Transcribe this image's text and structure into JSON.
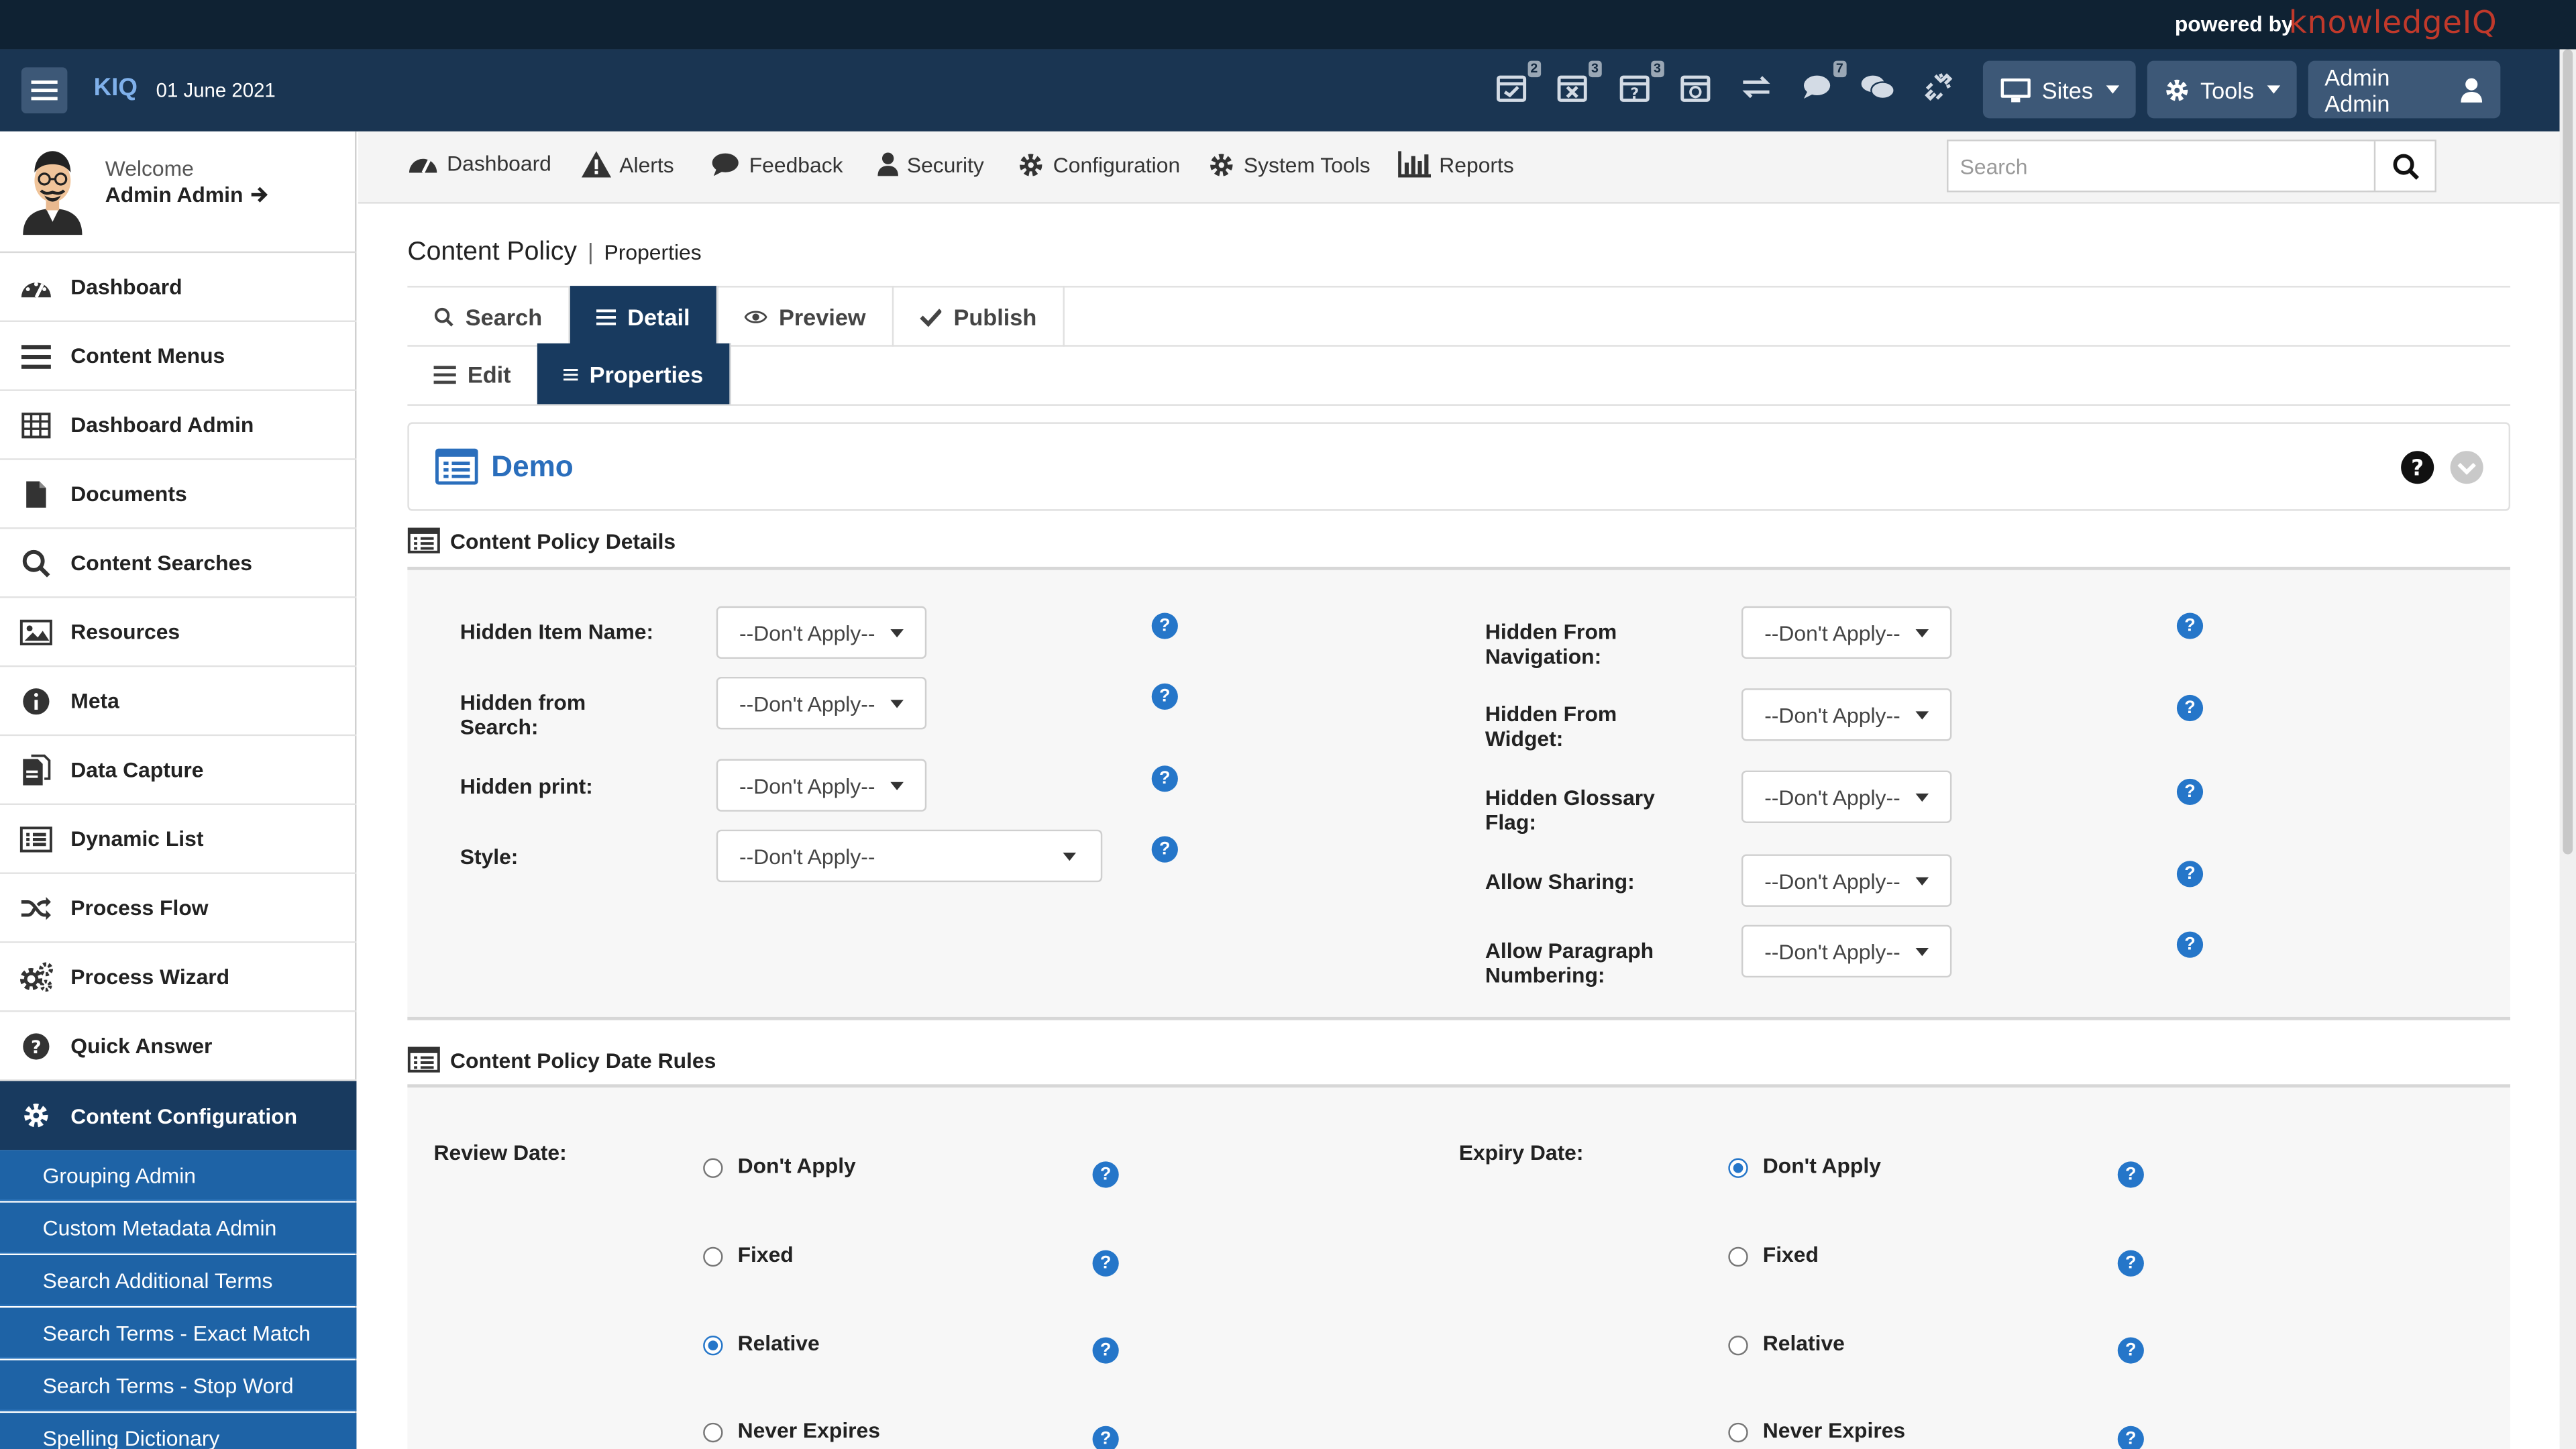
{
  "powered": {
    "text": "powered by",
    "logo": "knowledgeIQ"
  },
  "header": {
    "app_name": "KIQ",
    "date": "01 June 2021",
    "icons": [
      {
        "name": "calendar-check-icon",
        "badge": "2"
      },
      {
        "name": "calendar-times-icon",
        "badge": "3"
      },
      {
        "name": "calendar-question-icon",
        "badge": "3"
      },
      {
        "name": "calendar-clock-icon",
        "badge": ""
      },
      {
        "name": "exchange-icon",
        "badge": ""
      },
      {
        "name": "comment-icon",
        "badge": "7"
      },
      {
        "name": "comments-icon",
        "badge": ""
      },
      {
        "name": "unlink-icon",
        "badge": ""
      }
    ],
    "sites_label": "Sites",
    "tools_label": "Tools",
    "user_label": "Admin Admin"
  },
  "sidebar": {
    "welcome_label": "Welcome",
    "user_name": "Admin Admin",
    "items": [
      {
        "label": "Dashboard",
        "icon": "dashboard-icon"
      },
      {
        "label": "Content Menus",
        "icon": "menu-icon"
      },
      {
        "label": "Dashboard Admin",
        "icon": "table-icon"
      },
      {
        "label": "Documents",
        "icon": "document-icon"
      },
      {
        "label": "Content Searches",
        "icon": "search-icon"
      },
      {
        "label": "Resources",
        "icon": "image-icon"
      },
      {
        "label": "Meta",
        "icon": "info-icon"
      },
      {
        "label": "Data Capture",
        "icon": "data-capture-icon"
      },
      {
        "label": "Dynamic List",
        "icon": "list-icon"
      },
      {
        "label": "Process Flow",
        "icon": "random-icon"
      },
      {
        "label": "Process Wizard",
        "icon": "cogs-icon"
      },
      {
        "label": "Quick Answer",
        "icon": "question-icon"
      },
      {
        "label": "Content Configuration",
        "icon": "gear-icon"
      }
    ],
    "sub_items": [
      "Grouping Admin",
      "Custom Metadata Admin",
      "Search Additional Terms",
      "Search Terms - Exact Match",
      "Search Terms - Stop Word",
      "Spelling Dictionary"
    ]
  },
  "menubar": {
    "items": [
      "Dashboard",
      "Alerts",
      "Feedback",
      "Security",
      "Configuration",
      "System Tools",
      "Reports"
    ],
    "search_placeholder": "Search"
  },
  "main": {
    "breadcrumb_title": "Content Policy",
    "breadcrumb_sep": "|",
    "breadcrumb_sub": "Properties",
    "tabs_row1": [
      "Search",
      "Detail",
      "Preview",
      "Publish"
    ],
    "tabs_row2": [
      "Edit",
      "Properties"
    ],
    "panel_title": "Demo",
    "section1_title": "Content Policy Details",
    "left_fields": [
      {
        "label": "Hidden Item Name:",
        "value": "--Don't Apply--"
      },
      {
        "label": "Hidden from Search:",
        "value": "--Don't Apply--"
      },
      {
        "label": "Hidden print:",
        "value": "--Don't Apply--"
      },
      {
        "label": "Style:",
        "value": "--Don't Apply--"
      }
    ],
    "right_fields": [
      {
        "label": "Hidden From Navigation:",
        "value": "--Don't Apply--"
      },
      {
        "label": "Hidden From Widget:",
        "value": "--Don't Apply--"
      },
      {
        "label": "Hidden Glossary Flag:",
        "value": "--Don't Apply--"
      },
      {
        "label": "Allow Sharing:",
        "value": "--Don't Apply--"
      },
      {
        "label": "Allow Paragraph Numbering:",
        "value": "--Don't Apply--"
      }
    ],
    "section2_title": "Content Policy Date Rules",
    "review_label": "Review Date:",
    "expiry_label": "Expiry Date:",
    "date_options": [
      "Don't Apply",
      "Fixed",
      "Relative",
      "Never Expires"
    ],
    "review_selected": "Relative",
    "expiry_selected": "Don't Apply"
  },
  "colors": {
    "header": "#1a3552",
    "active": "#183a5f",
    "sub_nav": "#1e63a6",
    "accent": "#2576c9"
  }
}
